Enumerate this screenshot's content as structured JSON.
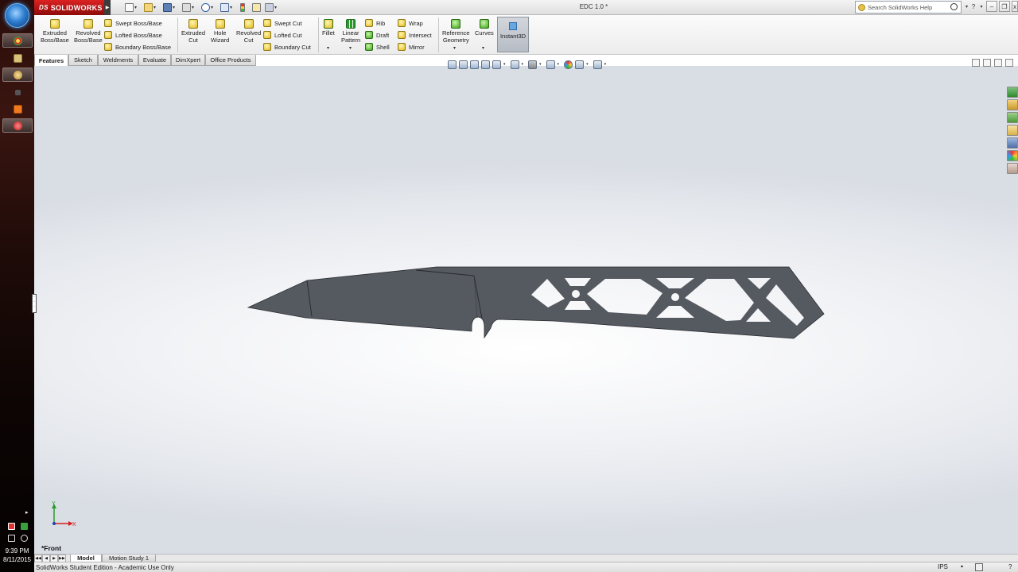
{
  "taskbar": {
    "start_icon": "windows-start-orb",
    "apps": [
      {
        "name": "chrome-icon",
        "color": "#e8b02a"
      },
      {
        "name": "explorer-icon",
        "color": "#d8c27a"
      },
      {
        "name": "solidworks-app-icon",
        "color": "#d4a83a"
      },
      {
        "name": "misc-app-icon",
        "color": "#9a9a9a"
      },
      {
        "name": "tasks-app-icon",
        "color": "#f07a1e"
      },
      {
        "name": "solidworks-red-icon",
        "color": "#d22828"
      }
    ],
    "clock_time": "9:39 PM",
    "clock_date": "8/11/2015"
  },
  "titlebar": {
    "logo_ds": "DS",
    "logo_text": "SOLIDWORKS",
    "document_title": "EDC 1.0 *",
    "search_placeholder": "Search SolidWorks Help",
    "help_icon": "help-icon"
  },
  "command_manager": {
    "big_buttons": [
      {
        "id": "extruded-boss",
        "line1": "Extruded",
        "line2": "Boss/Base"
      },
      {
        "id": "revolved-boss",
        "line1": "Revolved",
        "line2": "Boss/Base"
      },
      {
        "id": "extruded-cut",
        "line1": "Extruded",
        "line2": "Cut"
      },
      {
        "id": "hole-wizard",
        "line1": "Hole",
        "line2": "Wizard"
      },
      {
        "id": "revolved-cut",
        "line1": "Revolved",
        "line2": "Cut"
      },
      {
        "id": "fillet",
        "line1": "Fillet",
        "line2": ""
      },
      {
        "id": "linear-pattern",
        "line1": "Linear",
        "line2": "Pattern"
      },
      {
        "id": "reference-geometry",
        "line1": "Reference",
        "line2": "Geometry"
      },
      {
        "id": "curves",
        "line1": "Curves",
        "line2": ""
      }
    ],
    "small_buttons": {
      "swept_boss": "Swept Boss/Base",
      "lofted_boss": "Lofted Boss/Base",
      "boundary_boss": "Boundary Boss/Base",
      "swept_cut": "Swept Cut",
      "lofted_cut": "Lofted Cut",
      "boundary_cut": "Boundary Cut",
      "rib": "Rib",
      "draft": "Draft",
      "shell": "Shell",
      "wrap": "Wrap",
      "intersect": "Intersect",
      "mirror": "Mirror"
    },
    "instant3d": "Instant3D"
  },
  "tabs": [
    "Features",
    "Sketch",
    "Weldments",
    "Evaluate",
    "DimXpert",
    "Office Products"
  ],
  "viewport": {
    "view_name": "*Front",
    "triad_x": "X",
    "triad_y": "Y",
    "part_color": "#555960"
  },
  "bottom_tabs": [
    "Model",
    "Motion Study 1"
  ],
  "status": {
    "text": "SolidWorks Student Edition - Academic Use Only",
    "units": "IPS"
  }
}
